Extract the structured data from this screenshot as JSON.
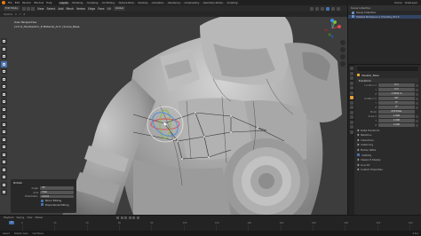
{
  "menubar": {
    "menus": [
      "File",
      "Edit",
      "Render",
      "Window",
      "Help"
    ],
    "tabs": [
      "Layout",
      "Modeling",
      "Sculpting",
      "UV Editing",
      "Texture Paint",
      "Shading",
      "Animation",
      "Rendering",
      "Compositing",
      "Geometry Nodes",
      "Scripting"
    ],
    "active_tab": "Layout",
    "right_items": [
      "Scene",
      "ViewLayer"
    ]
  },
  "viewport": {
    "mode": "Edit Mode",
    "header_items": [
      "View",
      "Select",
      "Add",
      "Mesh",
      "Vertex",
      "Edge",
      "Face",
      "UV"
    ],
    "transform_orientation": "Global",
    "sub_items": [
      "Options",
      "X",
      "Y",
      "Z"
    ],
    "info_title": "User Perspective",
    "info_object": "(17) K_Hoodie/Arm_R Material_Arm | Scene_Base",
    "gizmo": {
      "x_color": "#e0484e",
      "y_color": "#7dbf2f",
      "z_color": "#3f8ae8"
    }
  },
  "toolbar": {
    "tools": [
      "select-tool",
      "cursor-tool",
      "move-tool",
      "rotate-tool",
      "scale-tool",
      "transform-tool",
      "annotate-tool",
      "measure-tool",
      "add-cube-tool",
      "extrude-tool",
      "inset-tool",
      "bevel-tool",
      "loopcut-tool",
      "knife-tool",
      "polybuild-tool",
      "spin-tool",
      "smooth-tool",
      "edge-slide-tool",
      "shrink-tool",
      "shear-tool",
      "rip-tool"
    ],
    "active_index": 3
  },
  "operator_panel": {
    "title": "Rotate",
    "rows": [
      {
        "label": "Angle",
        "value": "32°"
      },
      {
        "label": "Axis",
        "value": "View"
      },
      {
        "label": "Orientation",
        "value": "Global"
      }
    ],
    "checks": [
      "Mirror Editing",
      "Proportional Editing"
    ]
  },
  "outliner": {
    "header": "Scene Collection",
    "items": [
      {
        "label": "Scene Collection",
        "selected": false
      },
      {
        "label": "Twisted Workpiece.1 (Hoodie)_ST.1X",
        "selected": true
      }
    ]
  },
  "properties": {
    "object_name": "Sweater_Base",
    "section_transform": "Transform",
    "rows": [
      {
        "label": "Location X",
        "value": "0 m"
      },
      {
        "label": "Y",
        "value": "0 m"
      },
      {
        "label": "Z",
        "value": "1.5094 m"
      },
      {
        "label": "Rotation X",
        "value": "90°"
      },
      {
        "label": "Y",
        "value": "0°"
      },
      {
        "label": "Z",
        "value": "0°"
      },
      {
        "label": "Mode",
        "value": "XYZ Euler"
      },
      {
        "label": "Scale X",
        "value": "1.000"
      },
      {
        "label": "Y",
        "value": "1.000"
      },
      {
        "label": "Z",
        "value": "1.000"
      }
    ],
    "subsections": [
      "Delta Transform",
      "Relations",
      "Collections",
      "Instancing",
      "Motion Paths",
      "Visibility",
      "Viewport Display",
      "Line Art",
      "Custom Properties"
    ],
    "checked_subsection": "Visibility"
  },
  "timeline": {
    "header_items": [
      "Playback",
      "Keying",
      "View",
      "Marker"
    ],
    "ticks": [
      "0",
      "20",
      "40",
      "60",
      "80",
      "100",
      "120",
      "140",
      "160",
      "180",
      "200",
      "220",
      "240"
    ],
    "current_frame": "1"
  },
  "statusbar": {
    "items": [
      "Select",
      "Rotate View",
      "Call Menu"
    ],
    "version": "3.6.0"
  }
}
